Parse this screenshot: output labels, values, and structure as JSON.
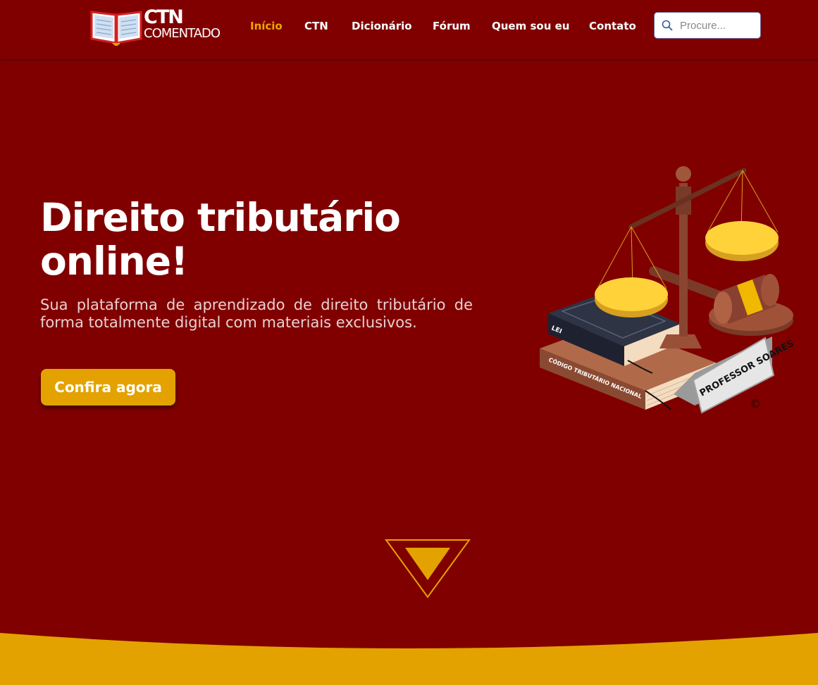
{
  "header": {
    "logo": {
      "line1": "CTN",
      "line2": "COMENTADO"
    },
    "nav": [
      {
        "label": "Início",
        "active": true
      },
      {
        "label": "CTN",
        "active": false
      },
      {
        "label": "Dicionário",
        "active": false
      },
      {
        "label": "Fórum",
        "active": false
      },
      {
        "label": "Quem sou eu",
        "active": false
      },
      {
        "label": "Contato",
        "active": false
      }
    ],
    "search": {
      "placeholder": "Procure...",
      "icon": "search-icon"
    }
  },
  "hero": {
    "title_line1": "Direito tributário",
    "title_line2": "online!",
    "subtitle": "Sua plataforma de aprendizado de direito tributário de forma totalmente digital com materiais exclusivos.",
    "cta_label": "Confira agora"
  },
  "illustration": {
    "book_top_label": "LEI",
    "book_bottom_label": "CÓDIGO TRIBUTÁRIO NACIONAL",
    "nameplate": "PROFESSOR SOARES",
    "copyright": "©"
  },
  "colors": {
    "background": "#800000",
    "accent": "#f0a500",
    "button": "#e3a200",
    "wave": "#e3a200"
  }
}
